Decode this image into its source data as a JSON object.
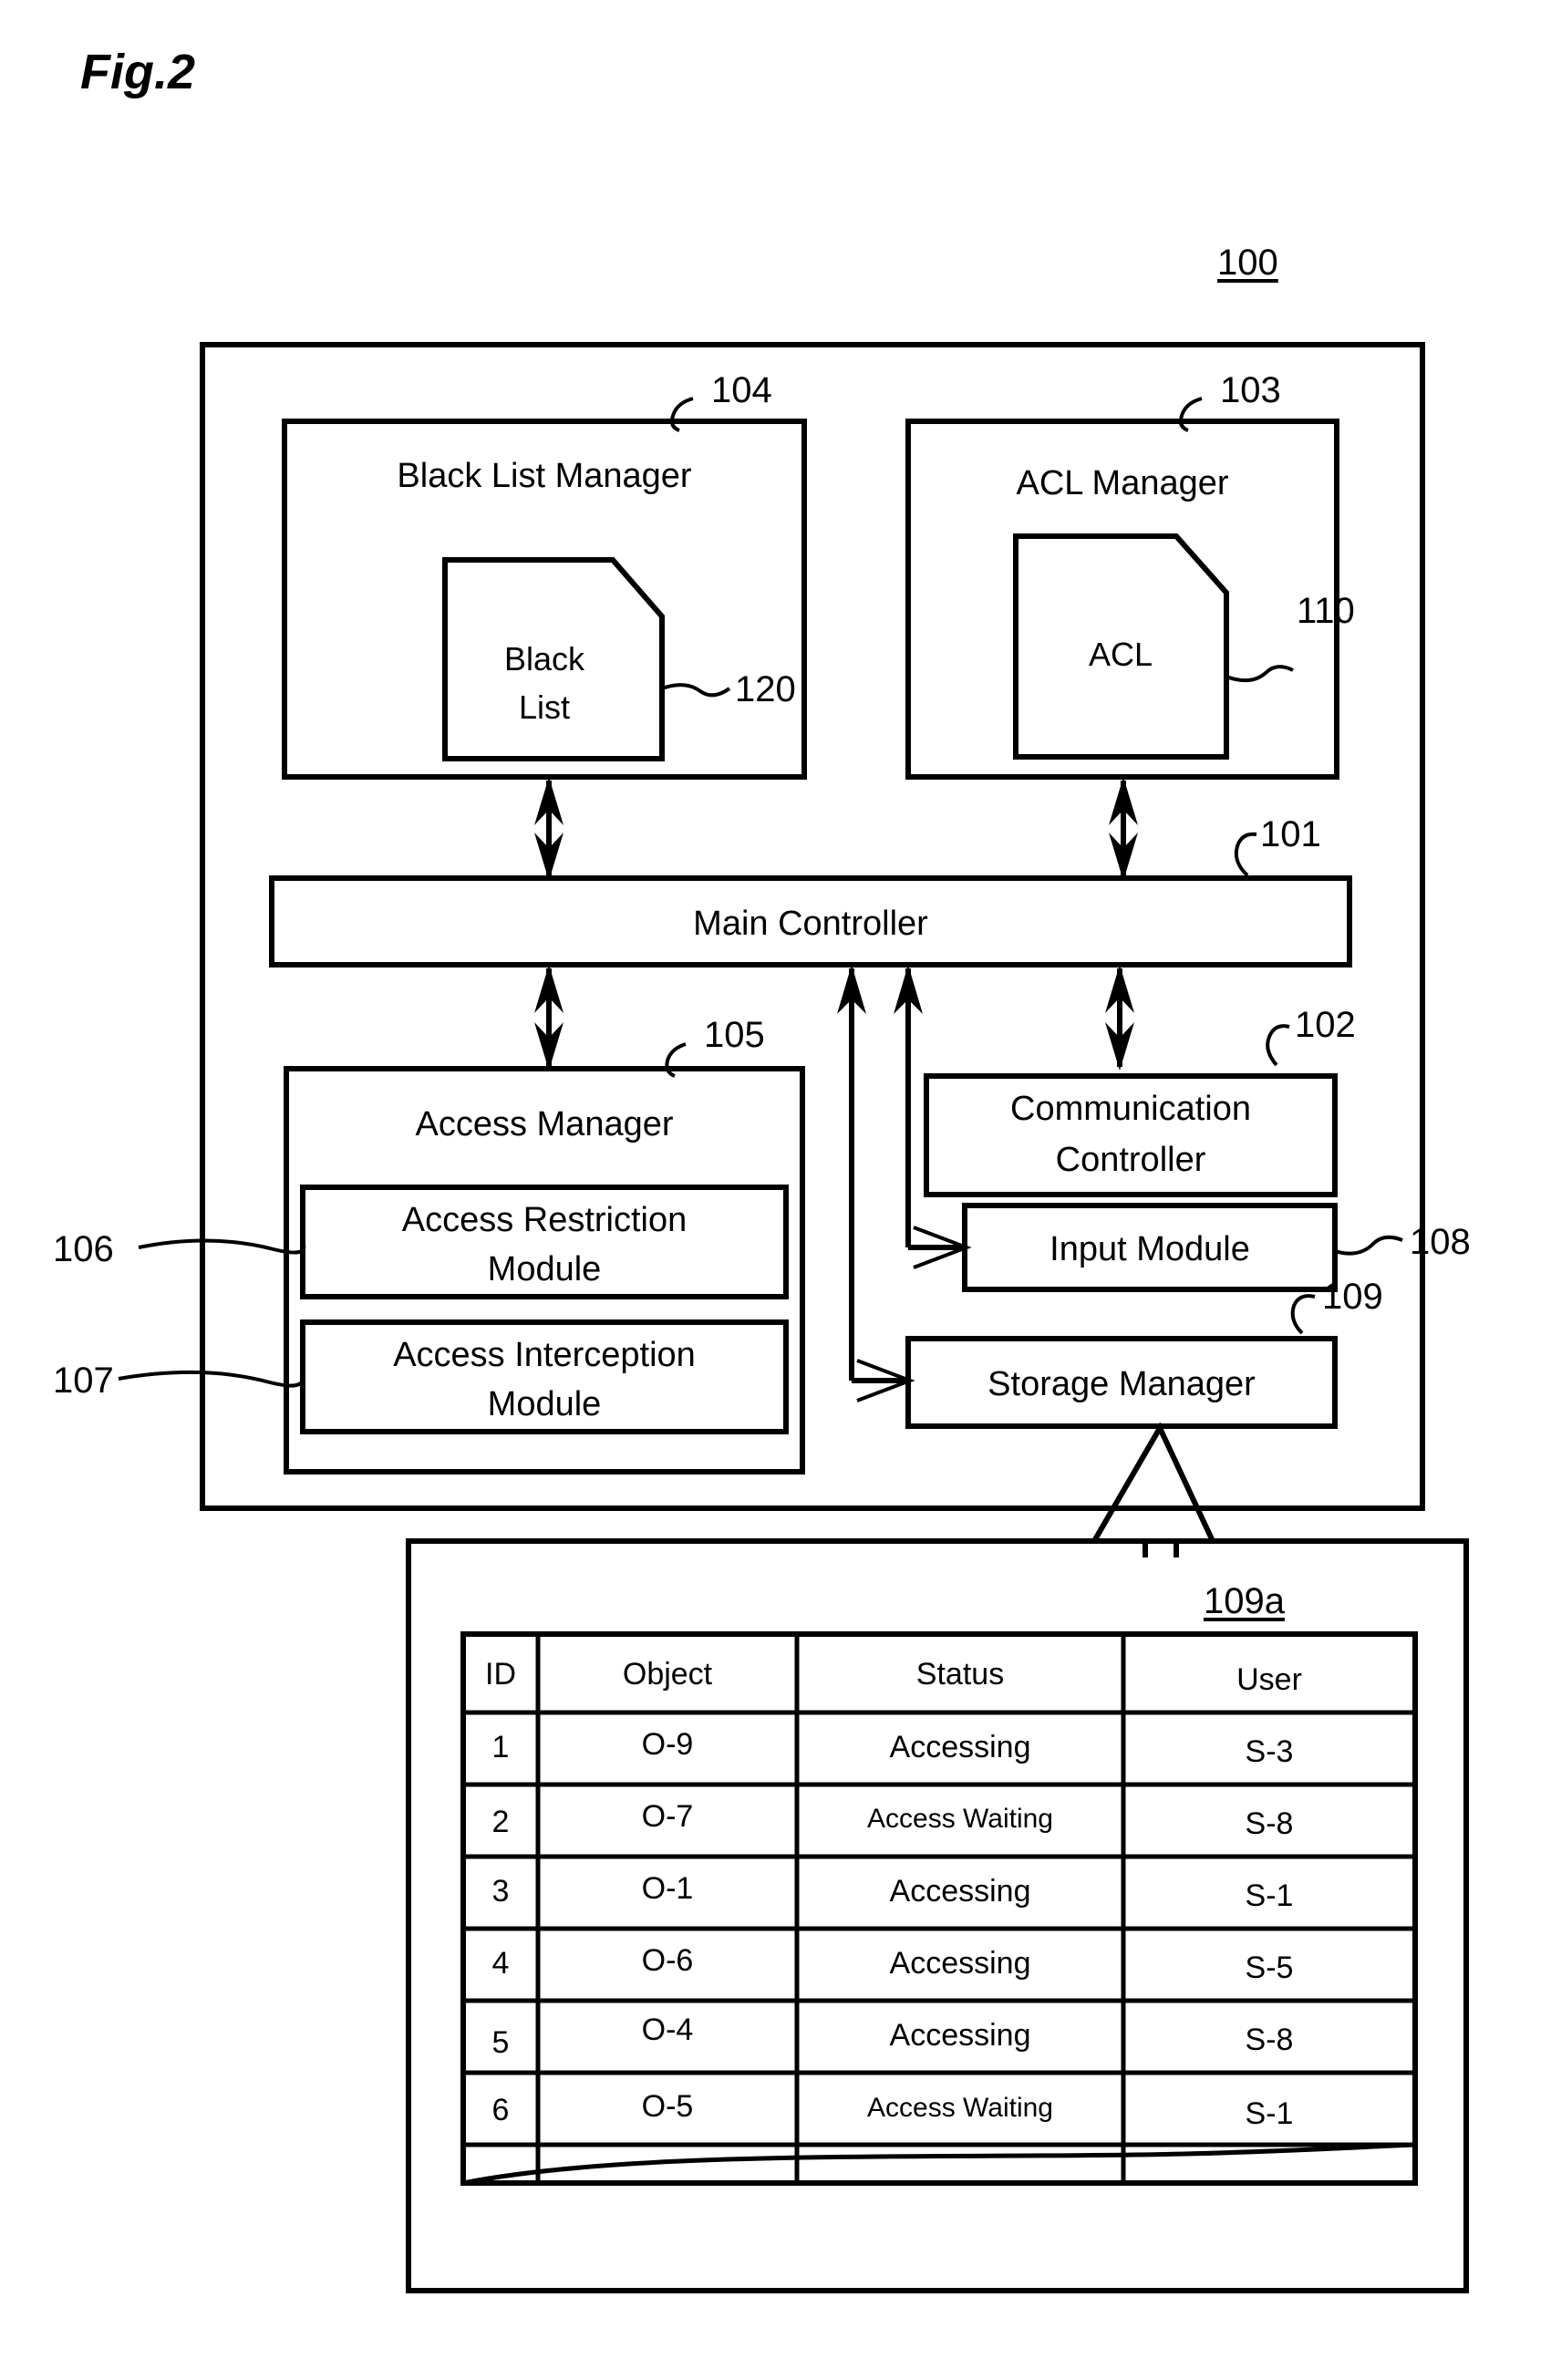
{
  "figure": {
    "title": "Fig.2",
    "system_ref": "100"
  },
  "blocks": {
    "black_list_manager": {
      "label": "Black List Manager",
      "ref": "104"
    },
    "black_list_doc": {
      "line1": "Black",
      "line2": "List",
      "ref": "120"
    },
    "acl_manager": {
      "label": "ACL Manager",
      "ref": "103"
    },
    "acl_doc": {
      "label": "ACL",
      "ref": "110"
    },
    "main_controller": {
      "label": "Main Controller",
      "ref": "101"
    },
    "access_manager": {
      "label": "Access Manager",
      "ref": "105"
    },
    "access_restriction_module": {
      "line1": "Access Restriction",
      "line2": "Module",
      "ref": "106"
    },
    "access_interception_module": {
      "line1": "Access Interception",
      "line2": "Module",
      "ref": "107"
    },
    "communication_controller": {
      "line1": "Communication",
      "line2": "Controller",
      "ref": "102"
    },
    "input_module": {
      "label": "Input Module",
      "ref": "108"
    },
    "storage_manager": {
      "label": "Storage Manager",
      "ref": "109"
    }
  },
  "detail_table": {
    "ref": "109a",
    "columns": [
      "ID",
      "Object",
      "Status",
      "User"
    ],
    "rows": [
      {
        "id": "1",
        "object": "O-9",
        "status": "Accessing",
        "user": "S-3"
      },
      {
        "id": "2",
        "object": "O-7",
        "status": "Access Waiting",
        "user": "S-8"
      },
      {
        "id": "3",
        "object": "O-1",
        "status": "Accessing",
        "user": "S-1"
      },
      {
        "id": "4",
        "object": "O-6",
        "status": "Accessing",
        "user": "S-5"
      },
      {
        "id": "5",
        "object": "O-4",
        "status": "Accessing",
        "user": "S-8"
      },
      {
        "id": "6",
        "object": "O-5",
        "status": "Access Waiting",
        "user": "S-1"
      }
    ]
  },
  "colors": {
    "ink": "#000000",
    "paper": "#ffffff"
  }
}
